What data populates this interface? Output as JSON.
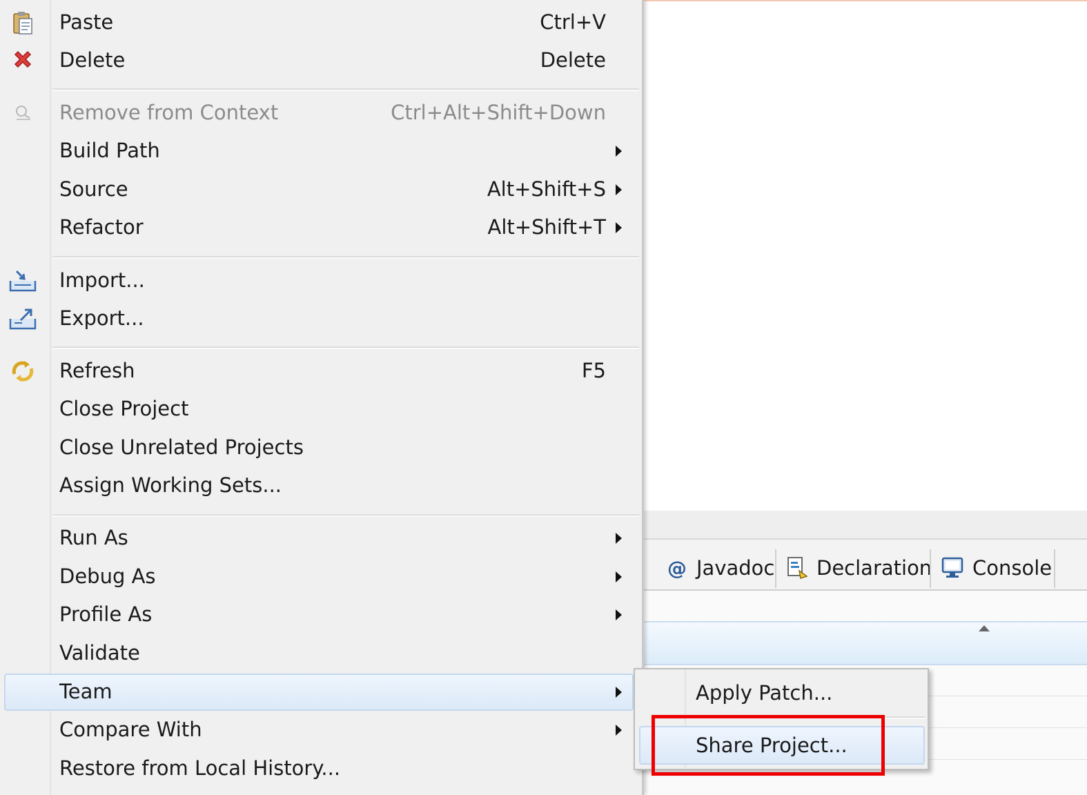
{
  "context_menu": {
    "items": [
      {
        "label": "Paste",
        "shortcut": "Ctrl+V",
        "icon": "paste-icon"
      },
      {
        "label": "Delete",
        "shortcut": "Delete",
        "icon": "delete-icon"
      },
      {
        "label": "Remove from Context",
        "shortcut": "Ctrl+Alt+Shift+Down",
        "icon": "remove-context-icon",
        "disabled": true
      },
      {
        "label": "Build Path",
        "submenu": true
      },
      {
        "label": "Source",
        "shortcut": "Alt+Shift+S",
        "submenu": true
      },
      {
        "label": "Refactor",
        "shortcut": "Alt+Shift+T",
        "submenu": true
      },
      {
        "label": "Import...",
        "icon": "import-icon"
      },
      {
        "label": "Export...",
        "icon": "export-icon"
      },
      {
        "label": "Refresh",
        "shortcut": "F5",
        "icon": "refresh-icon"
      },
      {
        "label": "Close Project"
      },
      {
        "label": "Close Unrelated Projects"
      },
      {
        "label": "Assign Working Sets..."
      },
      {
        "label": "Run As",
        "submenu": true
      },
      {
        "label": "Debug As",
        "submenu": true
      },
      {
        "label": "Profile As",
        "submenu": true
      },
      {
        "label": "Validate"
      },
      {
        "label": "Team",
        "submenu": true,
        "highlighted": true
      },
      {
        "label": "Compare With",
        "submenu": true
      },
      {
        "label": "Restore from Local History..."
      }
    ]
  },
  "team_submenu": {
    "items": [
      {
        "label": "Apply Patch..."
      },
      {
        "label": "Share Project...",
        "highlighted": true,
        "annotated": true
      }
    ]
  },
  "views": {
    "tabs": [
      {
        "label": "Javadoc",
        "icon": "javadoc-icon"
      },
      {
        "label": "Declaration",
        "icon": "declaration-icon"
      },
      {
        "label": "Console",
        "icon": "console-icon"
      }
    ]
  },
  "colors": {
    "menu_bg": "#f0f0f0",
    "highlight": "#dce9f8",
    "annotation": "#ee0000",
    "delete_icon": "#e03c3c"
  }
}
